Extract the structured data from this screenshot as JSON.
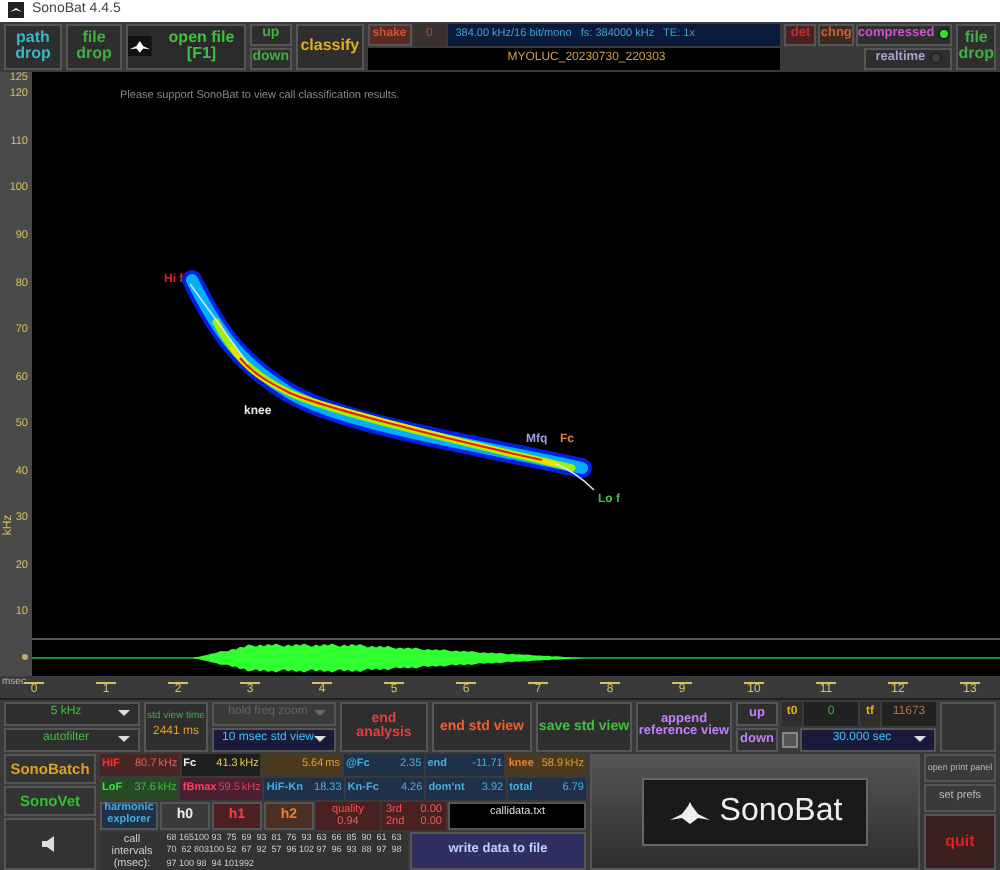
{
  "window": {
    "title": "SonoBat 4.4.5"
  },
  "toolbar": {
    "path_drop": "path drop",
    "file_drop": "file drop",
    "open_file": "open file [F1]",
    "up": "up",
    "down": "down",
    "classify": "classify",
    "shake": "shake",
    "shake_value": "0",
    "format_info": "384.00 kHz/16 bit/mono   fs: 384000 kHz   TE: 1x",
    "det": "det",
    "chng": "chng",
    "compressed": {
      "label": "compressed",
      "on": true
    },
    "realtime": {
      "label": "realtime",
      "on": false
    },
    "filename": "MYOLUC_20230730_220303",
    "file_drop_right": "file drop"
  },
  "plot": {
    "notice": "Please support SonoBat to view call classification results.",
    "y_label": "kHz",
    "y_ticks": [
      "125",
      "120",
      "110",
      "100",
      "90",
      "80",
      "70",
      "60",
      "50",
      "40",
      "30",
      "20",
      "10"
    ],
    "x_unit": "msec",
    "x_ticks": [
      "0",
      "1",
      "2",
      "3",
      "4",
      "5",
      "6",
      "7",
      "8",
      "9",
      "10",
      "11",
      "12",
      "13"
    ],
    "markers": [
      {
        "kind": "hi_f",
        "label": "Hi f"
      },
      {
        "kind": "knee",
        "label": "knee"
      },
      {
        "kind": "mfq",
        "label": "Mfq"
      },
      {
        "kind": "fc",
        "label": "Fc"
      },
      {
        "kind": "lo_f",
        "label": "Lo f"
      }
    ]
  },
  "view_controls": {
    "filter_freq": "5 kHz",
    "filter": "autofilter",
    "std_view_time_label": "std view time",
    "std_view_time": "2441 ms",
    "freq_zoom": {
      "label": "hold freq zoom",
      "disabled": true
    },
    "std_view": "10 msec std view",
    "end_analysis": "end analysis",
    "end_std_view": "end std view",
    "save_std_view": "save std view",
    "append_reference_view": "append reference view",
    "up": "up",
    "down": "down",
    "t0_label": "t0",
    "t0": "0",
    "tf_label": "tf",
    "tf": "11673",
    "lock": {
      "checked": false
    },
    "duration": "30.000 sec"
  },
  "modules": {
    "sonobatch": "SonoBatch",
    "sonovet": "SonoVet"
  },
  "measures": [
    [
      {
        "kind": "hif",
        "label": "HiF",
        "value": "80.7",
        "unit": "kHz"
      },
      {
        "kind": "fc",
        "label": "Fc",
        "value": "41.3",
        "unit": "kHz"
      },
      {
        "kind": "dur",
        "value": "5.64",
        "unit": "ms"
      },
      {
        "kind": "slope",
        "label": "@Fc",
        "value": "2.35"
      },
      {
        "kind": "slope",
        "label": "end",
        "value": "-11.71"
      },
      {
        "kind": "knee",
        "label": "knee",
        "value": "58.9",
        "unit": "kHz"
      }
    ],
    [
      {
        "kind": "lof",
        "label": "LoF",
        "value": "37.6",
        "unit": "kHz"
      },
      {
        "kind": "fbmax",
        "label": "fBmax",
        "value": "59.5",
        "unit": "kHz"
      },
      {
        "kind": "slope",
        "label": "HiF-Kn",
        "value": "18.33"
      },
      {
        "kind": "slope",
        "label": "Kn-Fc",
        "value": "4.26"
      },
      {
        "kind": "slope",
        "label": "dom'nt",
        "value": "3.92"
      },
      {
        "kind": "slope",
        "label": "total",
        "value": "6.79"
      }
    ]
  ],
  "harmonics": {
    "explorer": "harmonic explorer",
    "buttons": [
      "h0",
      "h1",
      "h2"
    ],
    "quality_label": "quality",
    "quality": "0.94",
    "third_label": "3rd",
    "third": "0.00",
    "second_label": "2nd",
    "second": "0.00",
    "data_file": "callidata.txt",
    "write": "write data to file"
  },
  "call_intervals": {
    "label": "call intervals (msec):",
    "rows": [
      [
        "68",
        "165",
        "100",
        "93",
        "75",
        "69",
        "93",
        "81",
        "76",
        "93",
        "63",
        "66",
        "85",
        "90",
        "61",
        "63"
      ],
      [
        "70",
        "62",
        "803",
        "100",
        "52",
        "67",
        "92",
        "57",
        "96",
        "102",
        "97",
        "96",
        "93",
        "88",
        "97",
        "98"
      ],
      [
        "97",
        "100",
        "98",
        "94",
        "101",
        "992"
      ]
    ]
  },
  "side": {
    "print": "open print panel",
    "prefs": "set prefs",
    "quit": "quit"
  },
  "logo": "SonoBat"
}
